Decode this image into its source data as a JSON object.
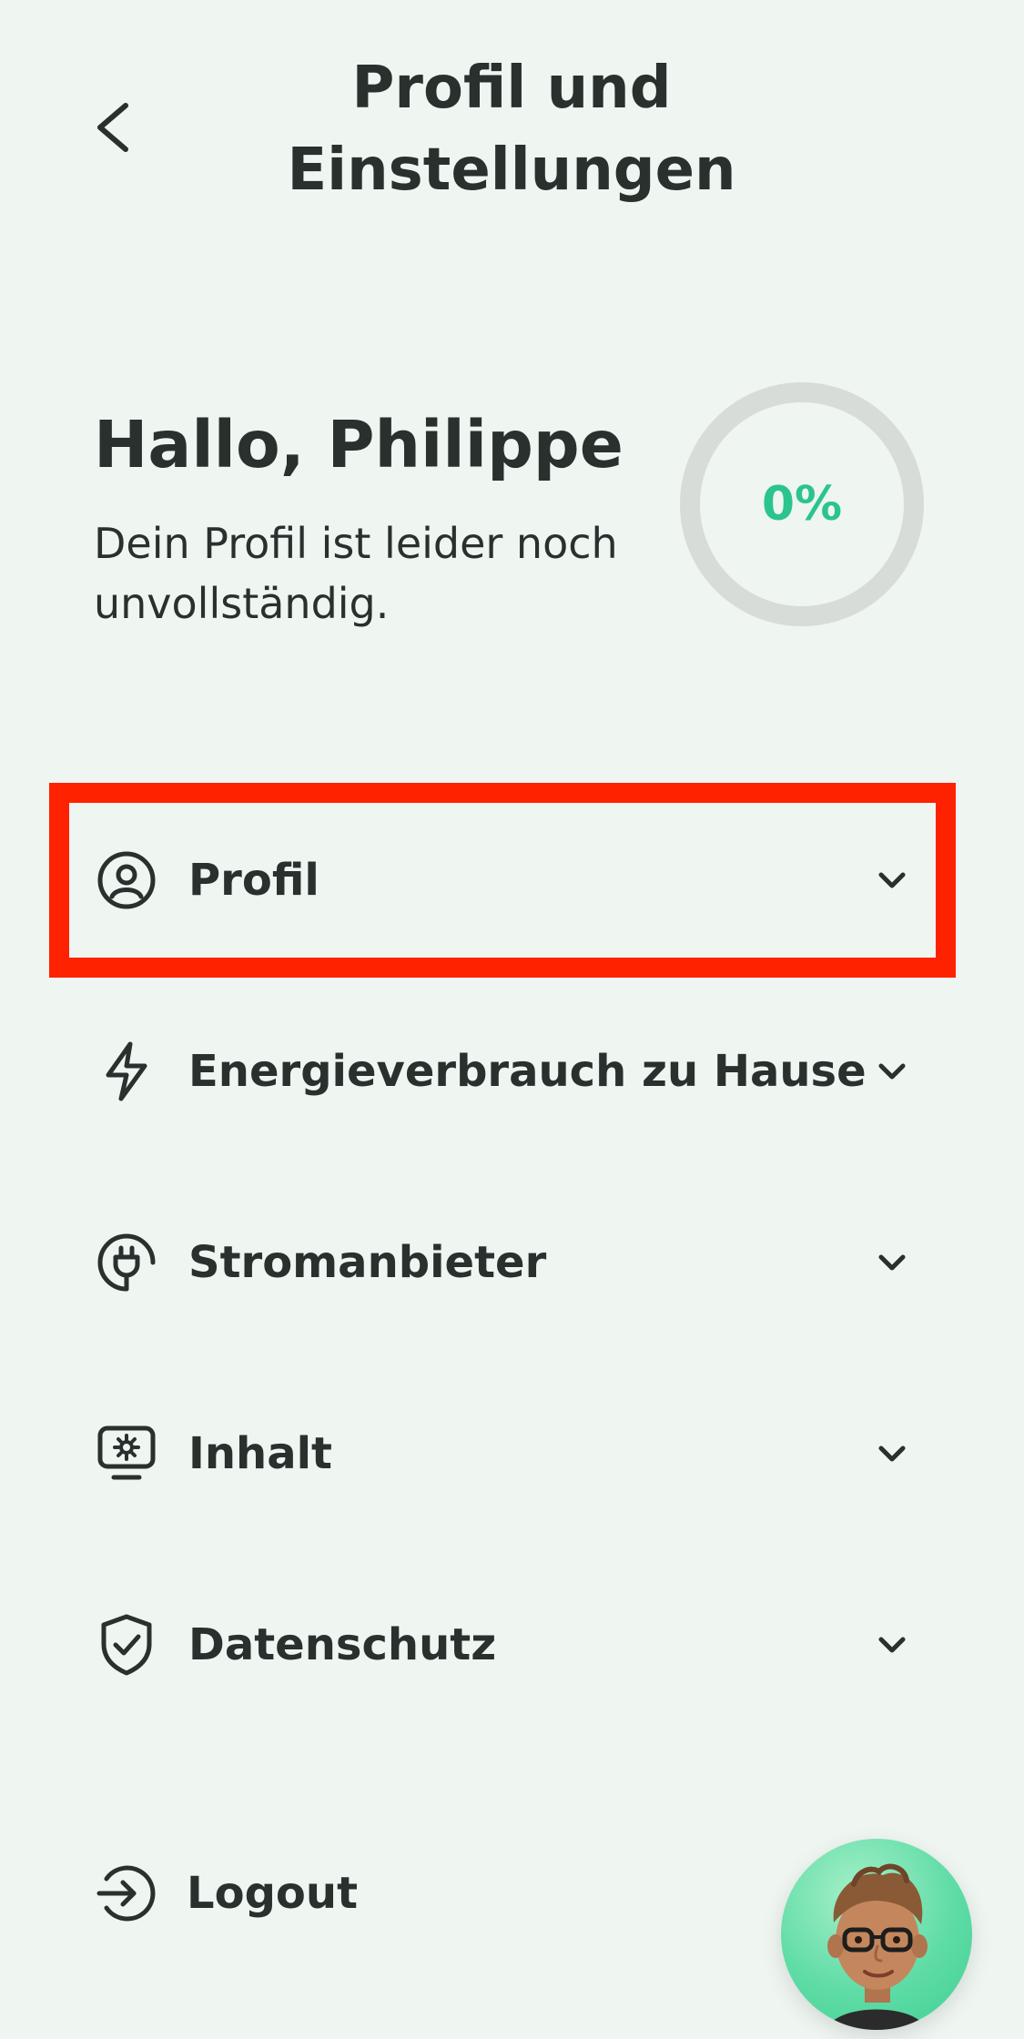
{
  "header": {
    "title_line1": "Profil und",
    "title_line2": "Einstellungen",
    "back_icon": "chevron-left-icon"
  },
  "profile_summary": {
    "greeting": "Hallo, Philippe",
    "status_text": "Dein Profil ist leider noch unvollständig.",
    "completion_label": "0%",
    "completion_fraction": 0
  },
  "sections": [
    {
      "label": "Profil",
      "icon": "user-circle-icon",
      "highlighted": true
    },
    {
      "label": "Energieverbrauch zu Hause",
      "icon": "lightning-bolt-icon"
    },
    {
      "label": "Stromanbieter",
      "icon": "plug-icon"
    },
    {
      "label": "Inhalt",
      "icon": "monitor-settings-icon"
    },
    {
      "label": "Datenschutz",
      "icon": "shield-check-icon"
    }
  ],
  "logout": {
    "label": "Logout",
    "icon": "logout-icon"
  },
  "colors": {
    "background": "#eff5f1",
    "text": "#29302d",
    "accent": "#2bc48f",
    "ring_track": "#d8dcd9",
    "highlight": "#ff2200"
  }
}
